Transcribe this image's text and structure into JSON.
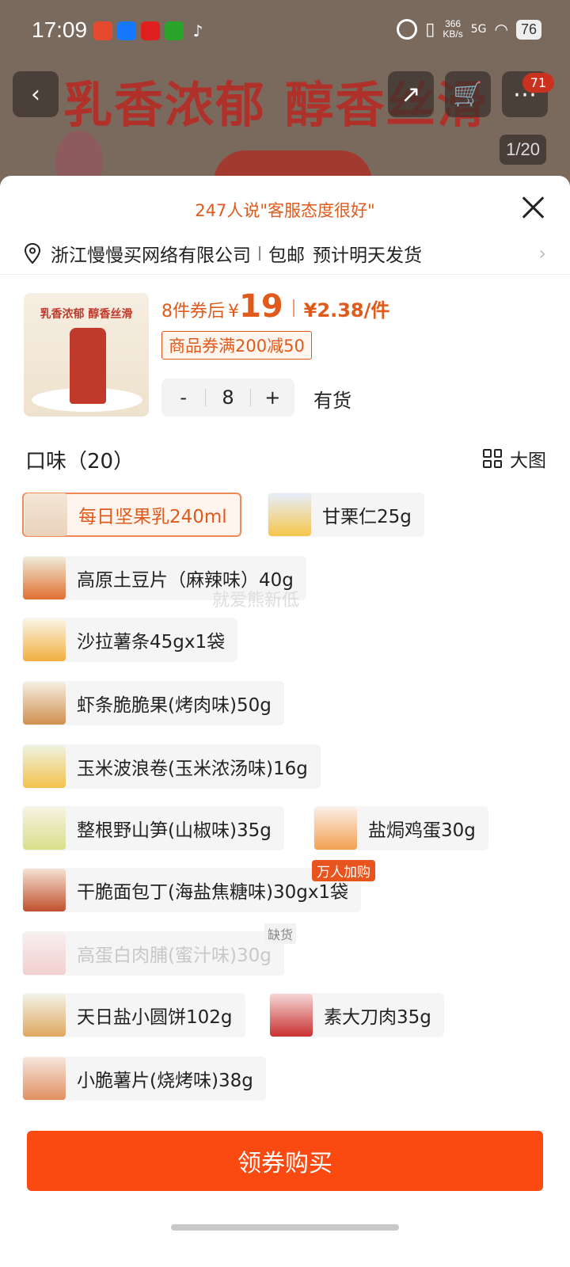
{
  "status_bar": {
    "time": "17:09",
    "net_speed": "366",
    "net_unit": "KB/s",
    "signal": "5G",
    "battery": "76"
  },
  "background": {
    "banner": "乳香浓郁 醇香丝滑",
    "cart_badge": "71",
    "page_indicator": "1/20"
  },
  "sheet": {
    "praise": "247人说\"客服态度很好\"",
    "shipping": {
      "company": "浙江慢慢买网络有限公司",
      "free_shipping": "包邮",
      "dispatch": "预计明天发货"
    },
    "product": {
      "thumb_text": "乳香浓郁 醇香丝滑",
      "price_prefix": "8件券后",
      "currency": "¥",
      "price": "19",
      "unit_price": "¥2.38/件",
      "coupon": "商品券满200减50",
      "quantity": "8",
      "minus": "-",
      "plus": "+",
      "stock": "有货"
    },
    "flavor": {
      "title": "口味（20）",
      "big_image_label": "大图",
      "options": [
        {
          "label": "每日坚果乳240ml",
          "selected": true
        },
        {
          "label": "甘栗仁25g"
        },
        {
          "label": "高原土豆片（麻辣味）40g"
        },
        {
          "label": "沙拉薯条45gx1袋"
        },
        {
          "label": "虾条脆脆果(烤肉味)50g"
        },
        {
          "label": "玉米波浪卷(玉米浓汤味)16g"
        },
        {
          "label": "整根野山笋(山椒味)35g"
        },
        {
          "label": "盐焗鸡蛋30g"
        },
        {
          "label": "干脆面包丁(海盐焦糖味)30gx1袋",
          "tag": "万人加购"
        },
        {
          "label": "高蛋白肉脯(蜜汁味)30g",
          "tag": "缺货",
          "disabled": true
        },
        {
          "label": "天日盐小圆饼102g"
        },
        {
          "label": "素大刀肉35g"
        },
        {
          "label": "小脆薯片(烧烤味)38g"
        }
      ]
    },
    "watermark": "就爱熊新低",
    "buy_button": "领券购买"
  },
  "colors": {
    "accent": "#e05a1c",
    "buy": "#fa4a12"
  }
}
